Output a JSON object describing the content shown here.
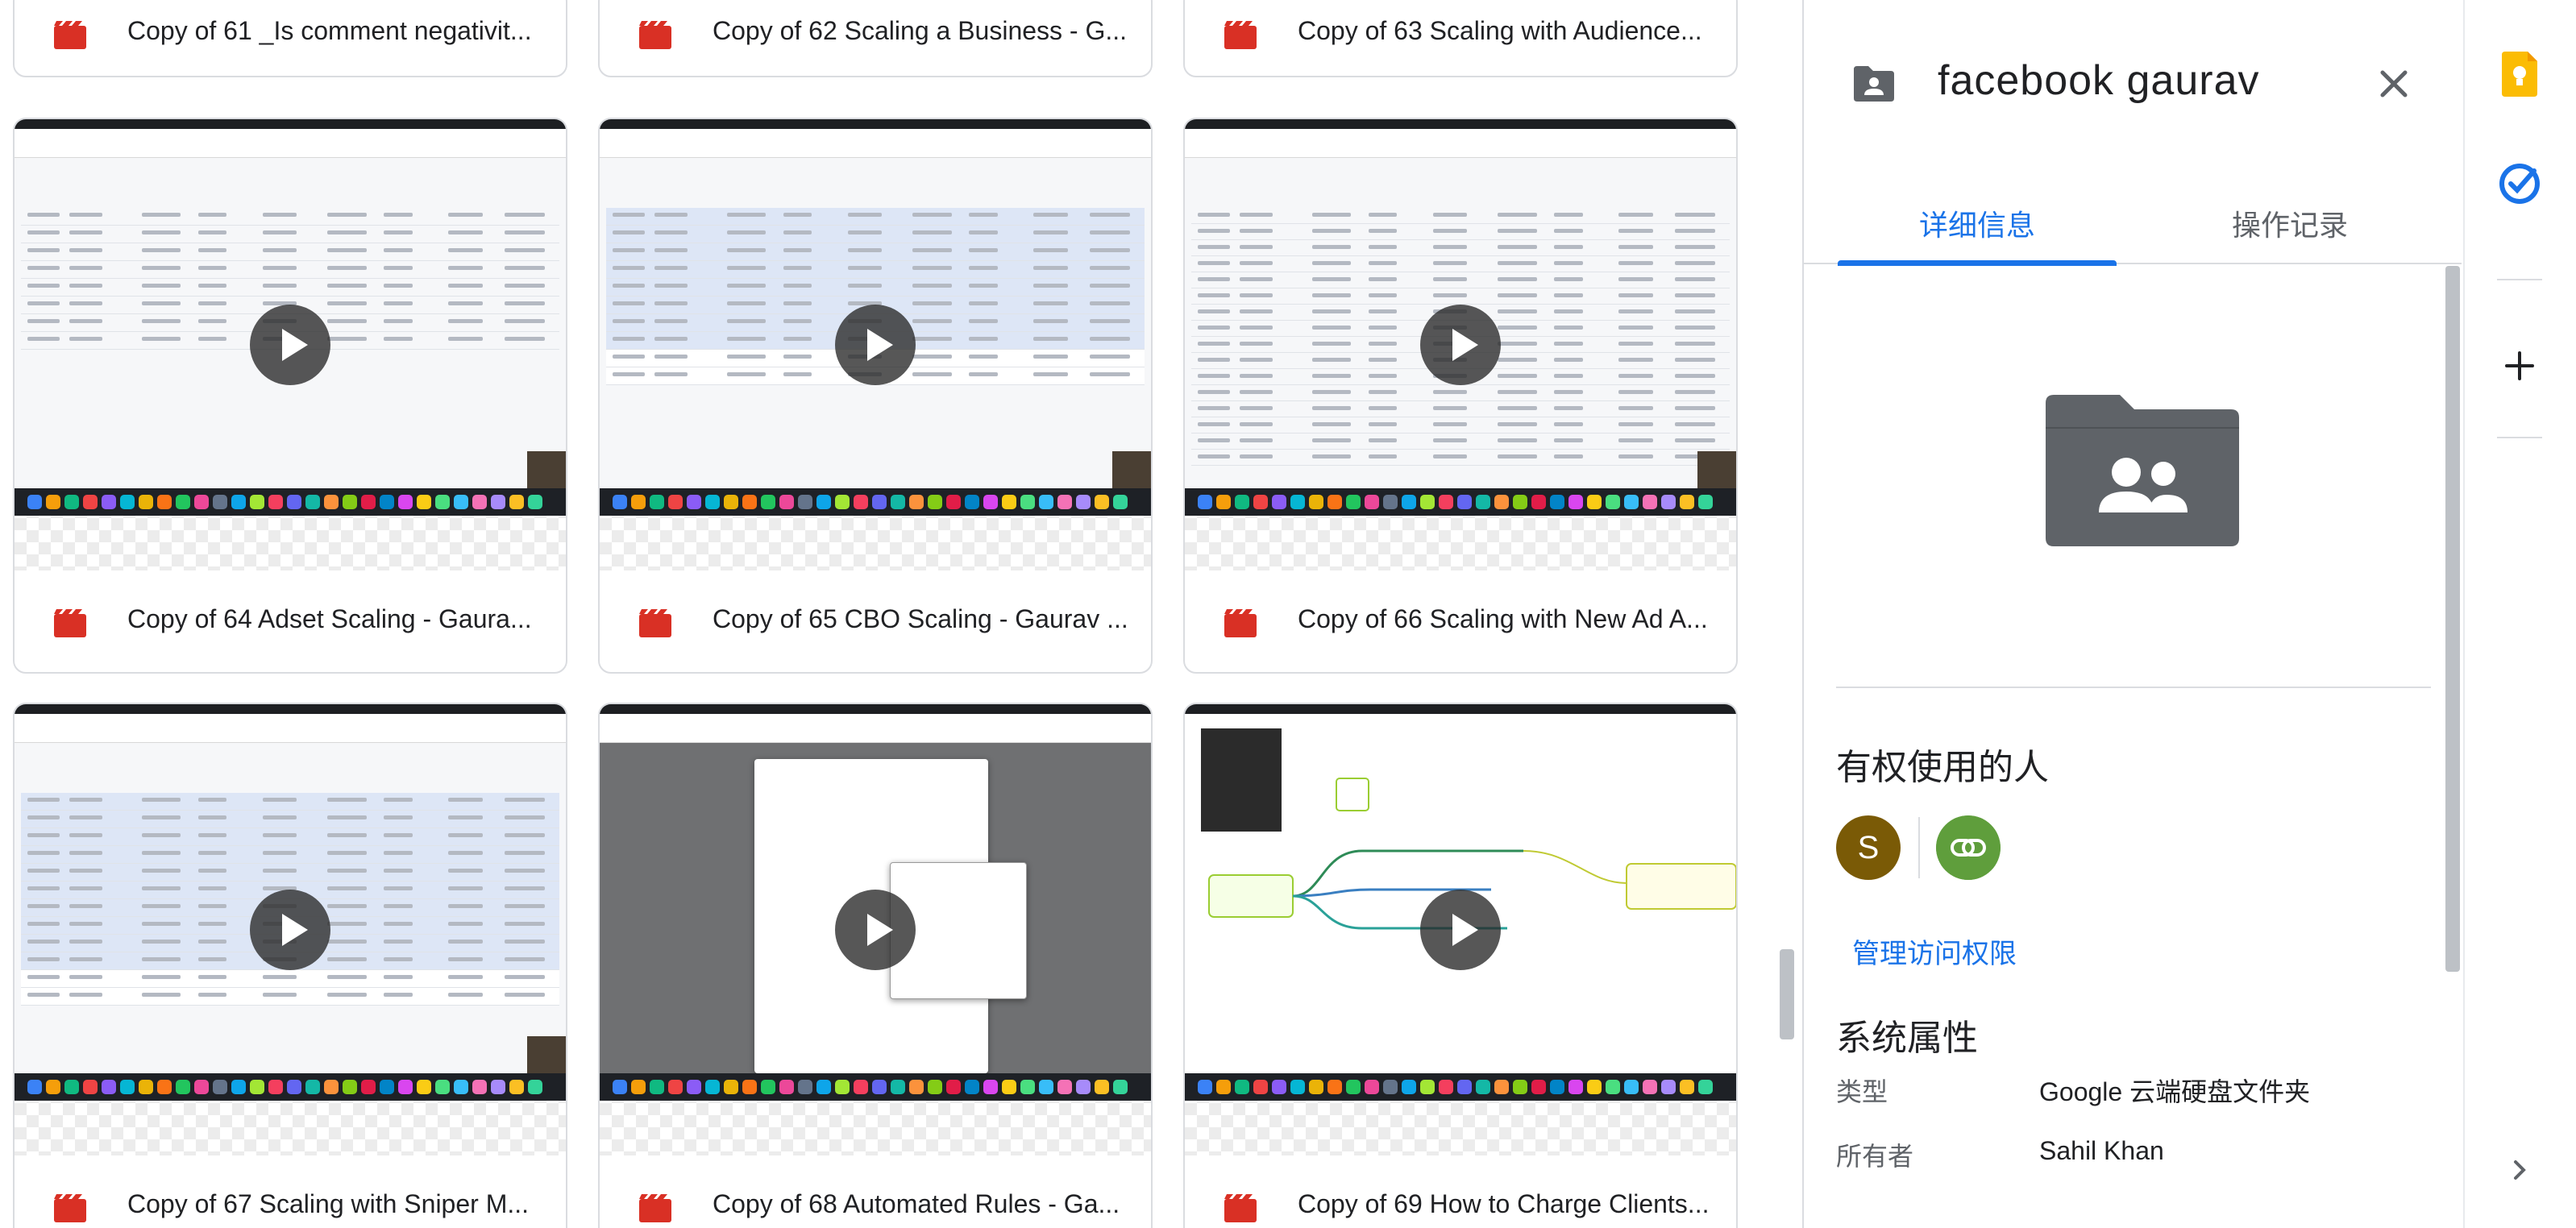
{
  "files": [
    {
      "title": "Copy of 61 _Is comment negativit...",
      "icon": "video-file-icon"
    },
    {
      "title": "Copy of 62 Scaling a Business - G...",
      "icon": "video-file-icon"
    },
    {
      "title": "Copy of 63 Scaling with Audience...",
      "icon": "video-file-icon"
    },
    {
      "title": "Copy of 64 Adset Scaling - Gaura...",
      "icon": "video-file-icon"
    },
    {
      "title": "Copy of 65 CBO Scaling - Gaurav ...",
      "icon": "video-file-icon"
    },
    {
      "title": "Copy of 66 Scaling with New Ad A...",
      "icon": "video-file-icon"
    },
    {
      "title": "Copy of 67 Scaling with Sniper M...",
      "icon": "video-file-icon"
    },
    {
      "title": "Copy of 68 Automated Rules - Ga...",
      "icon": "video-file-icon"
    },
    {
      "title": "Copy of 69 How to Charge Clients...",
      "icon": "video-file-icon"
    }
  ],
  "details": {
    "folder_name": "facebook gaurav",
    "tabs": [
      "详细信息",
      "操作记录"
    ],
    "access_title": "有权使用的人",
    "owner_initial": "S",
    "manage_access": "管理访问权限",
    "system_props_title": "系统属性",
    "props": [
      {
        "label": "类型",
        "value": "Google 云端硬盘文件夹"
      },
      {
        "label": "所有者",
        "value": "Sahil Khan"
      }
    ]
  },
  "colors": {
    "accent": "#1a73e8",
    "video_icon": "#d93025",
    "avatar_s": "#7a5a06",
    "link_avatar": "#5f9e3c",
    "keep_yellow": "#fbbc04"
  },
  "rail_icons": [
    "keep-icon",
    "tasks-icon",
    "add-icon",
    "expand-icon"
  ]
}
